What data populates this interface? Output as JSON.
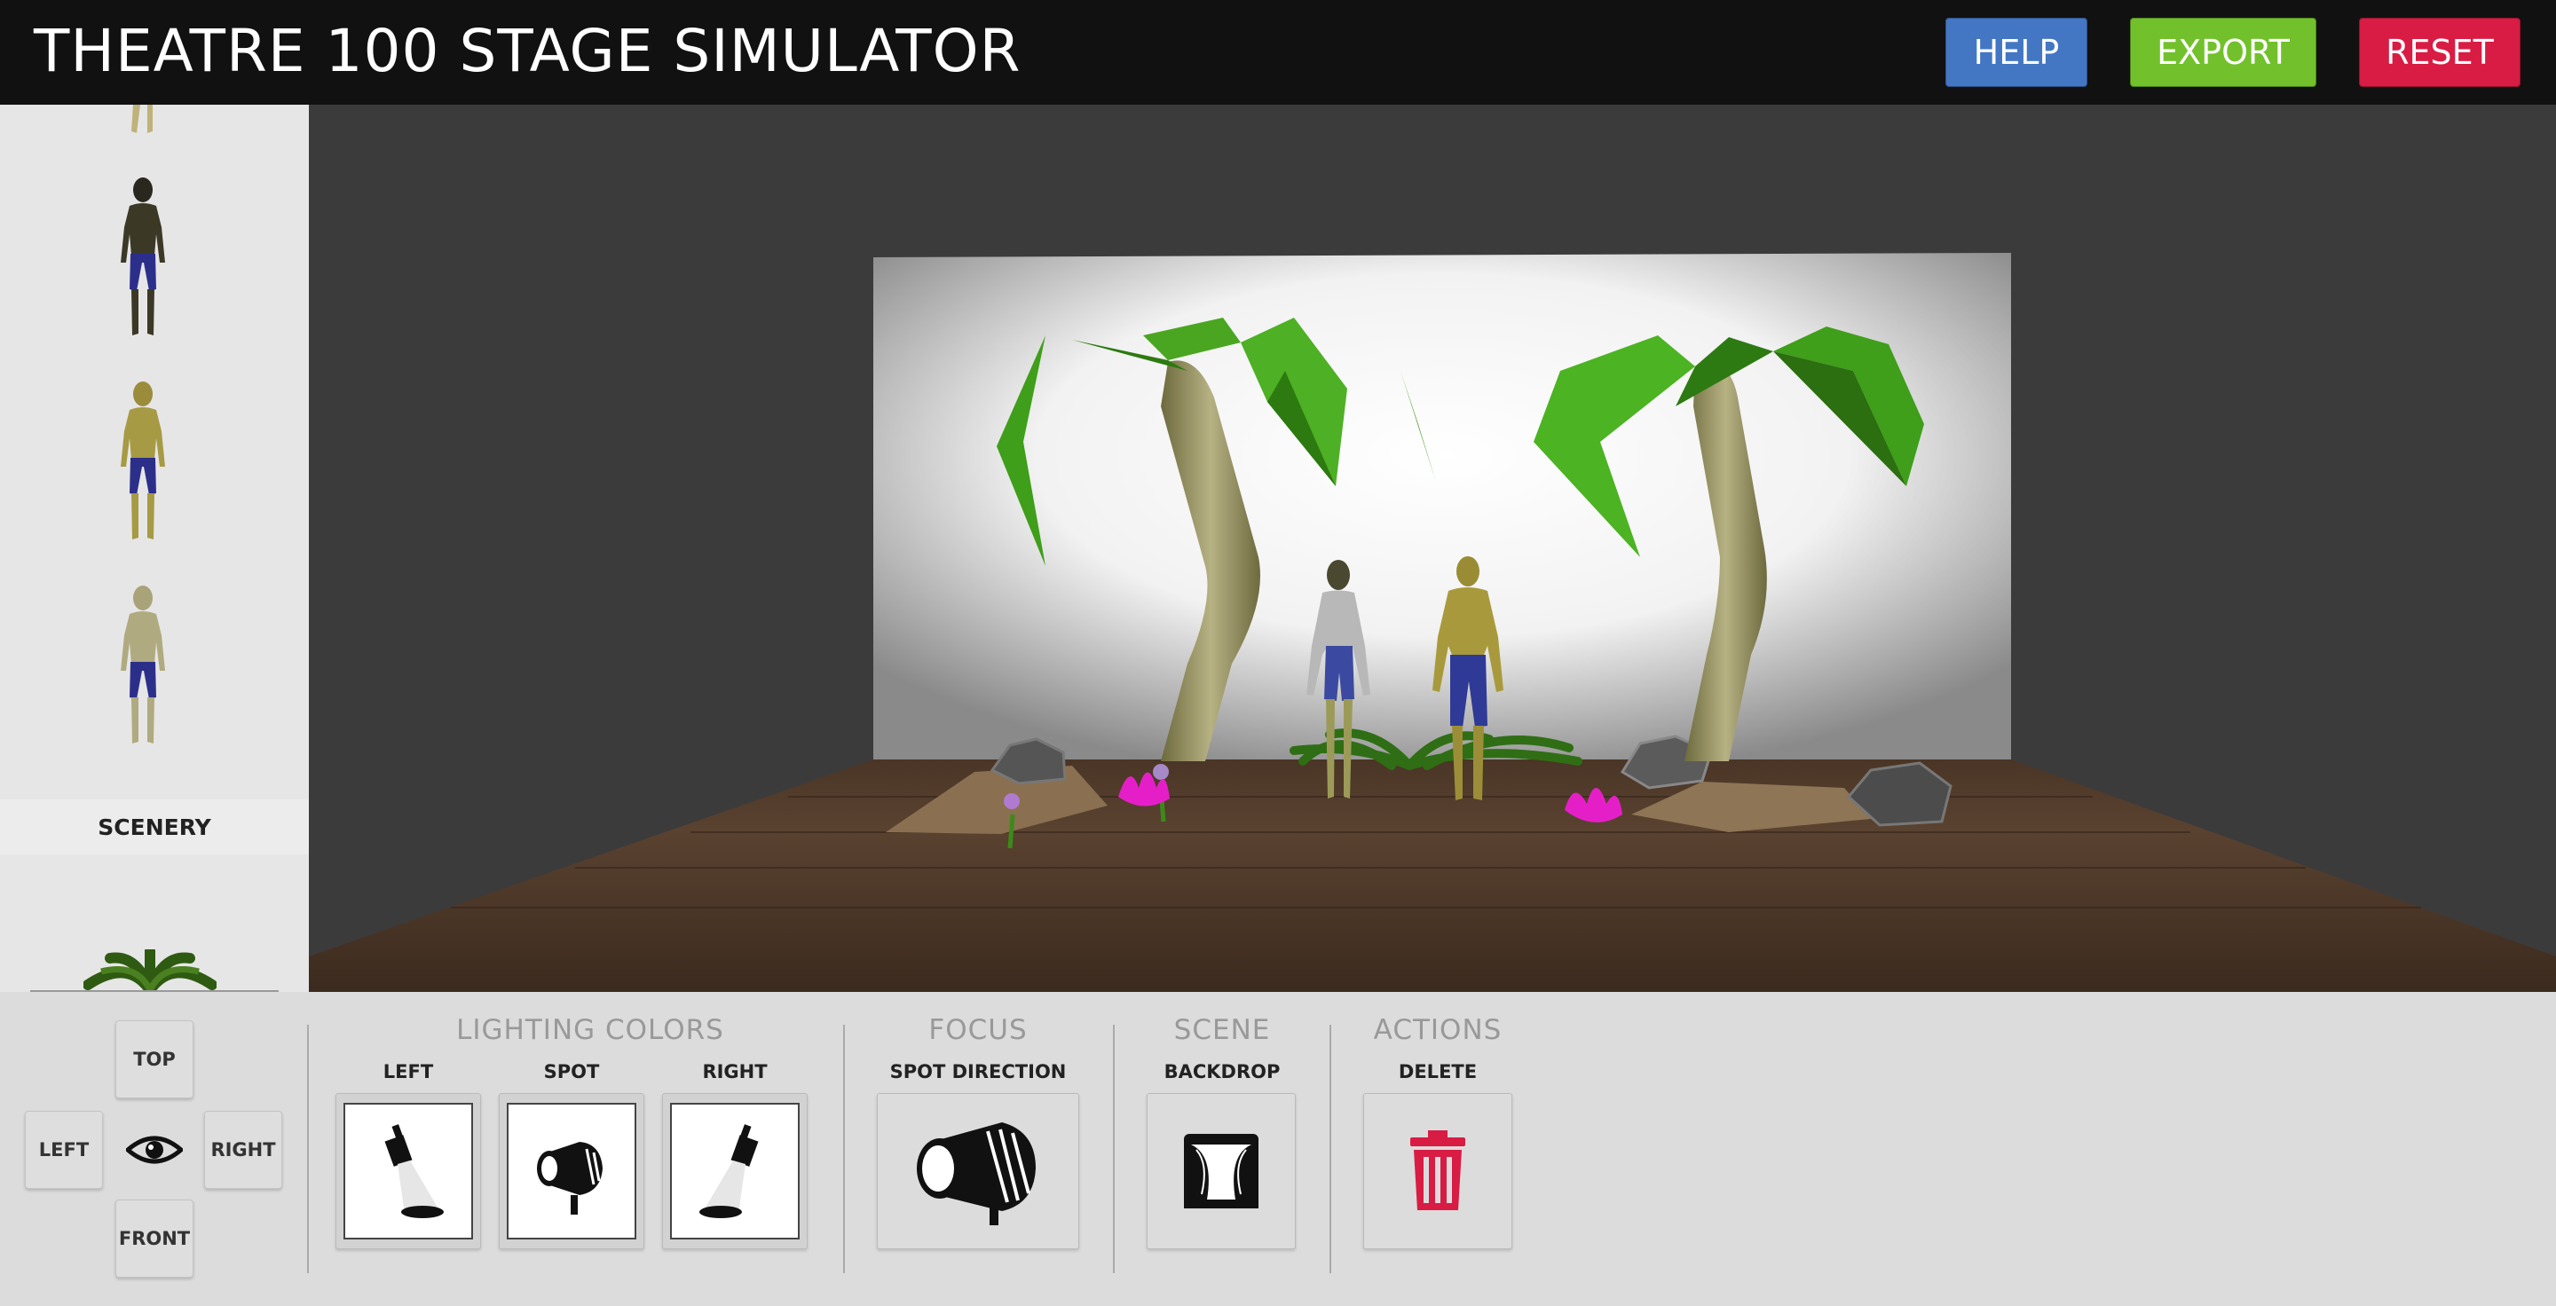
{
  "header": {
    "title": "THEATRE 100 STAGE SIMULATOR",
    "buttons": {
      "help": "HELP",
      "export": "EXPORT",
      "reset": "RESET"
    }
  },
  "sidebar": {
    "section_scenery": "SCENERY",
    "actors": [
      "actor-dark",
      "actor-olive",
      "actor-pale"
    ]
  },
  "camera": {
    "top": "TOP",
    "left": "LEFT",
    "right": "RIGHT",
    "front": "FRONT",
    "center_icon": "eye-icon"
  },
  "lighting": {
    "title": "LIGHTING COLORS",
    "items": [
      {
        "label": "LEFT",
        "icon": "left-light-icon"
      },
      {
        "label": "SPOT",
        "icon": "spotlight-icon"
      },
      {
        "label": "RIGHT",
        "icon": "right-light-icon"
      }
    ]
  },
  "focus": {
    "title": "FOCUS",
    "item": {
      "label": "SPOT DIRECTION",
      "icon": "spot-direction-icon"
    }
  },
  "scene": {
    "title": "SCENE",
    "item": {
      "label": "BACKDROP",
      "icon": "curtain-icon"
    }
  },
  "actions": {
    "title": "ACTIONS",
    "item": {
      "label": "DELETE",
      "icon": "trash-icon"
    }
  },
  "colors": {
    "help": "#4377c4",
    "export": "#72c12c",
    "reset": "#d81c44",
    "topbar": "#111111",
    "delete": "#d81c44"
  }
}
